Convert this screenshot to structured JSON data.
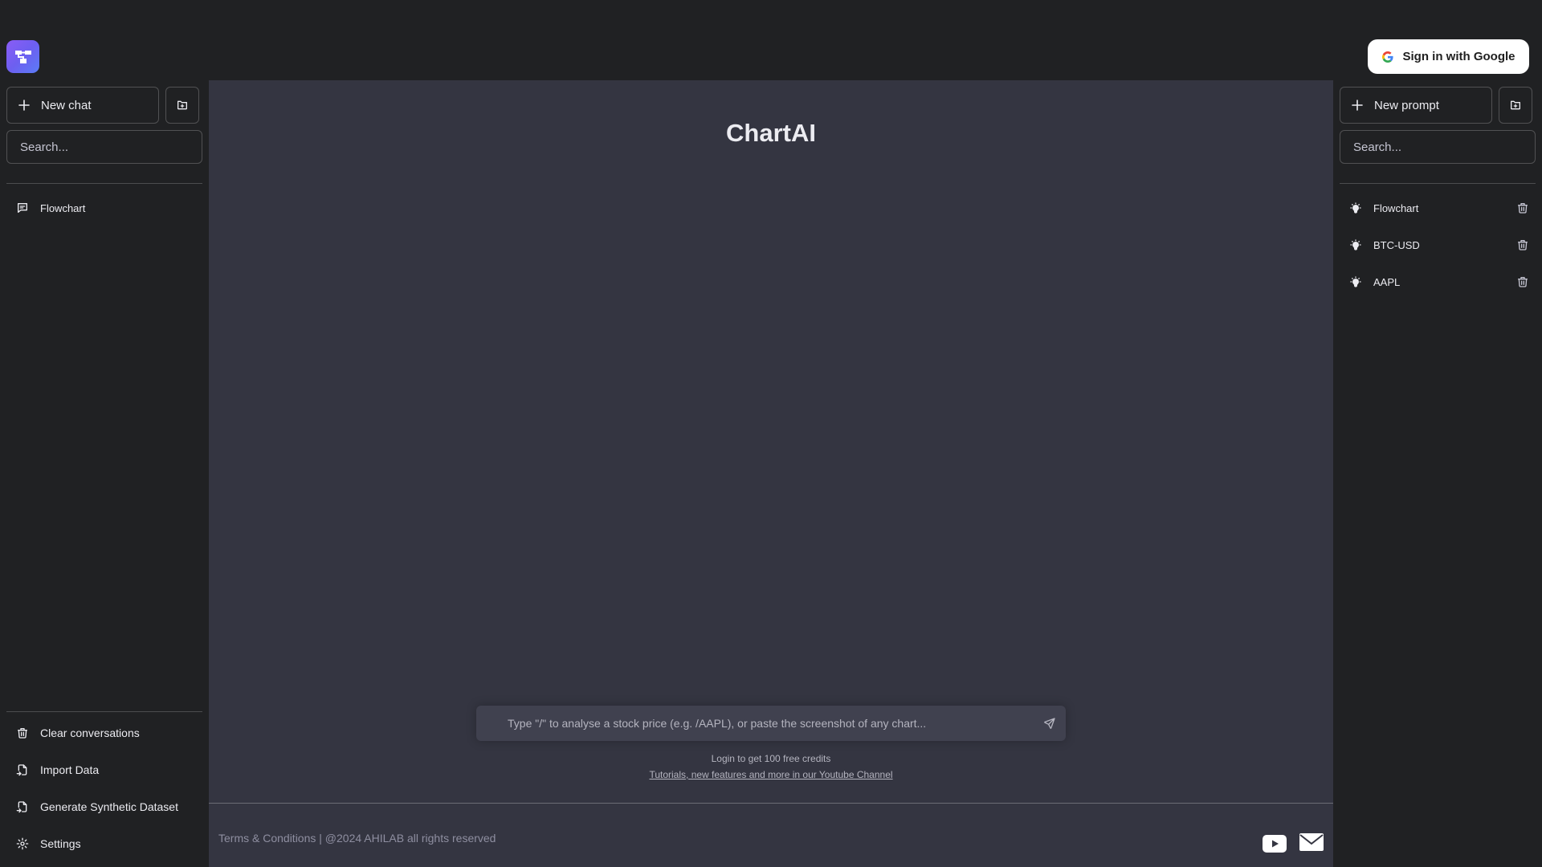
{
  "header": {
    "logo_icon": "app-logo-icon",
    "signin_label": "Sign in with Google"
  },
  "left_sidebar": {
    "new_chat_label": "New chat",
    "search_placeholder": "Search...",
    "conversations": [
      {
        "label": "Flowchart",
        "icon": "message-icon"
      }
    ],
    "bottom_items": [
      {
        "label": "Clear conversations",
        "icon": "trash-icon"
      },
      {
        "label": "Import Data",
        "icon": "file-import-icon"
      },
      {
        "label": "Generate Synthetic Dataset",
        "icon": "file-icon"
      },
      {
        "label": "Settings",
        "icon": "gear-icon"
      }
    ]
  },
  "right_sidebar": {
    "new_prompt_label": "New prompt",
    "search_placeholder": "Search...",
    "prompts": [
      {
        "label": "Flowchart",
        "icon": "bulb-icon"
      },
      {
        "label": "BTC-USD",
        "icon": "bulb-icon"
      },
      {
        "label": "AAPL",
        "icon": "bulb-icon"
      }
    ]
  },
  "main": {
    "title": "ChartAI",
    "input_placeholder": "Type \"/\" to analyse a stock price (e.g. /AAPL), or paste the screenshot of any chart...",
    "credits_text": "Login to get 100 free credits",
    "tutorial_link": "Tutorials, new features and more in our Youtube Channel",
    "footer_terms": "Terms & Conditions",
    "footer_copyright": "| @2024 AHILAB all rights reserved"
  },
  "colors": {
    "sidebar_bg": "#202123",
    "main_bg": "#343541",
    "input_bg": "#40414f",
    "accent": "#7c5cf5"
  }
}
